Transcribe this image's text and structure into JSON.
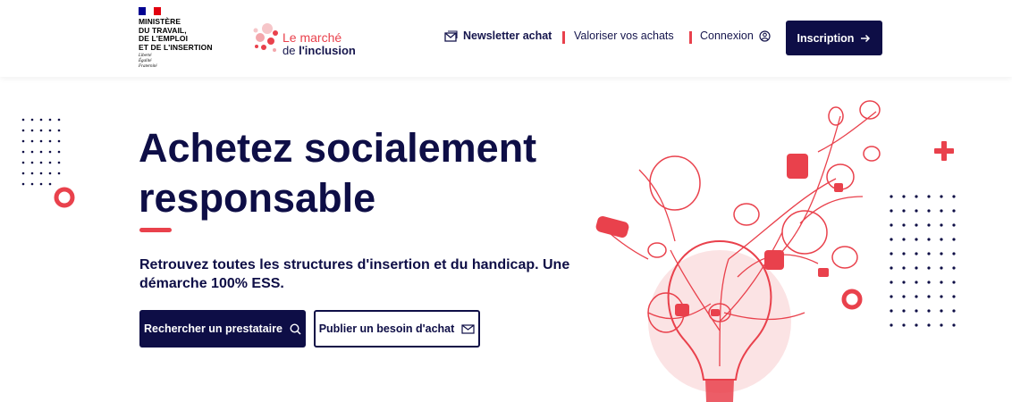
{
  "header": {
    "gov_logo": {
      "ministry": "MINISTÈRE\nDU TRAVAIL,\nDE L'EMPLOI\nET DE L'INSERTION",
      "motto": "Liberté\nÉgalité\nFraternité"
    },
    "brand": {
      "line1": "Le marché",
      "line2_prefix": "de ",
      "line2_bold": "l'inclusion"
    },
    "nav": {
      "newsletter": "Newsletter achat",
      "valoriser": "Valoriser vos achats",
      "connexion": "Connexion"
    },
    "signup_button": "Inscription"
  },
  "hero": {
    "title": "Achetez socialement responsable",
    "subtitle": "Retrouvez toutes les structures d'insertion et du handicap. Une démarche 100% ESS.",
    "search_button": "Rechercher un prestataire",
    "publish_button": "Publier un besoin d'achat"
  },
  "colors": {
    "navy": "#0e0e46",
    "accent_red": "#e9414c",
    "flag_blue": "#000091",
    "flag_red": "#e1000f",
    "pale_pink": "#fbe3e4"
  },
  "icons": [
    "newsletter-icon",
    "user-icon",
    "arrow-right-icon",
    "search-icon",
    "mail-icon"
  ]
}
